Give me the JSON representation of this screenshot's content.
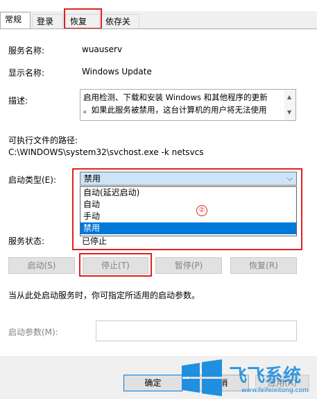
{
  "tabs": [
    "常规",
    "登录",
    "恢复",
    "依存关系"
  ],
  "fields": {
    "service_name_label": "服务名称:",
    "service_name_value": "wuauserv",
    "display_name_label": "显示名称:",
    "display_name_value": "Windows Update",
    "description_label": "描述:",
    "description_line1": "启用检测、下载和安装 Windows 和其他程序的更新",
    "description_line2": "。如果此服务被禁用，这台计算机的用户将无法使用",
    "exe_path_label": "可执行文件的路径:",
    "exe_path_value": "C:\\WINDOWS\\system32\\svchost.exe -k netsvcs",
    "startup_type_label": "启动类型(E):",
    "startup_type_value": "禁用",
    "startup_options": [
      "自动(延迟启动)",
      "自动",
      "手动",
      "禁用"
    ],
    "service_status_label": "服务状态:",
    "service_status_value": "已停止"
  },
  "service_buttons": [
    "启动(S)",
    "停止(T)",
    "暂停(P)",
    "恢复(R)"
  ],
  "hint_text": "当从此处启动服务时，你可指定所适用的启动参数。",
  "param_label": "启动参数(M):",
  "param_value": "",
  "dialog_buttons": {
    "ok": "确定",
    "cancel": "取消",
    "apply": "应用(A)"
  },
  "annotation_number": "②",
  "watermark": {
    "brand": "飞飞系统",
    "url": "www.feifeixitong.com"
  },
  "colors": {
    "accent": "#0078d7",
    "highlight_red": "#e02020",
    "selected_combo": "#cce4f7"
  },
  "icons": [
    "chevron-down-icon",
    "scroll-up-icon",
    "scroll-down-icon",
    "windows-logo-icon"
  ]
}
